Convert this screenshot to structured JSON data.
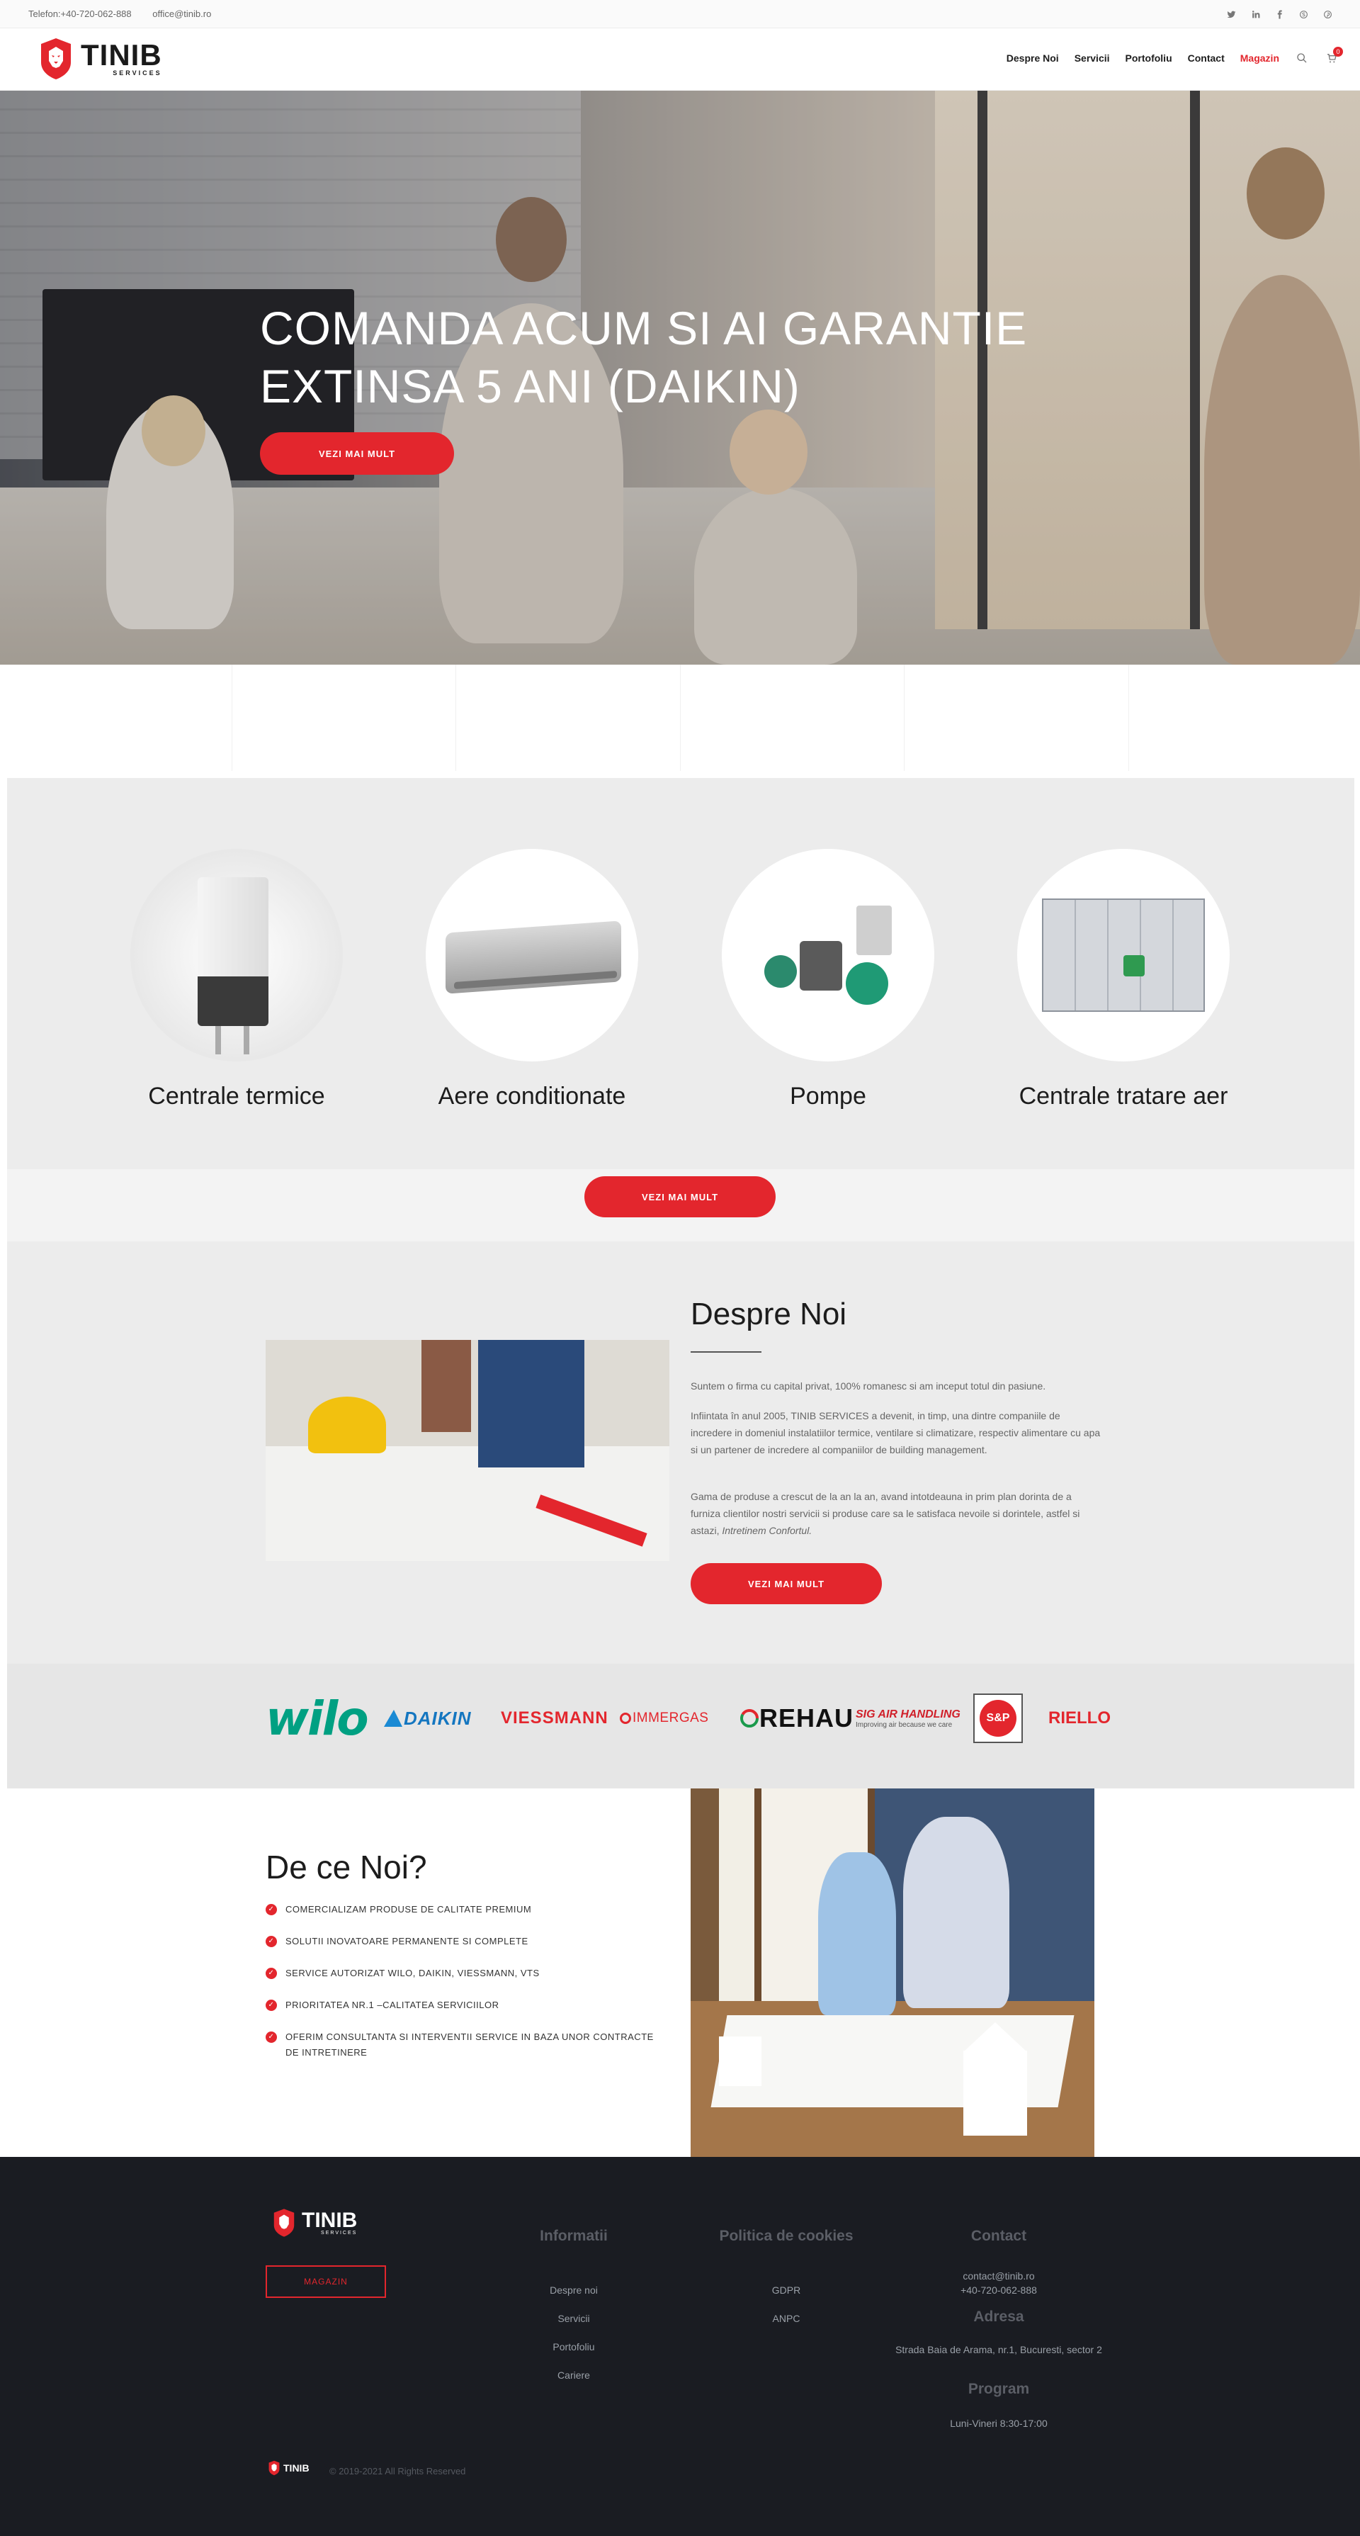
{
  "topbar": {
    "phone": "Telefon:+40-720-062-888",
    "email": "office@tinib.ro",
    "social": [
      "twitter-icon",
      "linkedin-icon",
      "facebook-icon",
      "skype-icon",
      "pinterest-icon"
    ]
  },
  "header": {
    "logo_main": "TINIB",
    "logo_sub": "SERVICES",
    "nav": [
      "Despre Noi",
      "Servicii",
      "Portofoliu",
      "Contact",
      "Magazin"
    ],
    "cart_count": "0"
  },
  "hero": {
    "title_line1": "COMANDA ACUM SI AI GARANTIE",
    "title_line2": "EXTINSA 5 ANI (DAIKIN)",
    "button": "VEZI MAI MULT"
  },
  "products": {
    "items": [
      "Centrale termice",
      "Aere conditionate",
      "Pompe",
      "Centrale tratare aer"
    ],
    "button": "VEZI MAI MULT"
  },
  "about": {
    "title": "Despre Noi",
    "p1": "Suntem o firma cu capital privat, 100% romanesc si am inceput totul din pasiune.",
    "p2": "Infiintata în anul 2005, TINIB SERVICES a devenit, in timp, una dintre companiile de incredere in domeniul instalatiilor termice, ventilare si climatizare, respectiv alimentare cu apa si un partener de incredere al companiilor de building management.",
    "p3": "Gama de produse a crescut de la an la an, avand intotdeauna in prim plan dorinta de a furniza clientilor nostri servicii si produse care sa le satisfaca nevoile si dorintele, astfel si astazi,",
    "p3_em": "Intretinem Confortul.",
    "button": "VEZI MAI MULT"
  },
  "brands": [
    "wilo",
    "DAIKIN",
    "VIESSMANN",
    "IMMERGAS",
    "REHAU",
    "SIG AIR HANDLING",
    "S&P",
    "RIELLO"
  ],
  "brands_extra": {
    "sig_tagline": "Improving air because we care"
  },
  "why": {
    "title": "De ce Noi?",
    "items": [
      "COMERCIALIZAM PRODUSE DE CALITATE PREMIUM",
      "SOLUTII INOVATOARE PERMANENTE SI COMPLETE",
      "SERVICE AUTORIZAT WILO, DAIKIN, VIESSMANN, VTS",
      "PRIORITATEA NR.1 –CALITATEA SERVICIILOR",
      "OFERIM CONSULTANTA SI INTERVENTII SERVICE IN BAZA UNOR CONTRACTE DE INTRETINERE"
    ]
  },
  "footer": {
    "logo_main": "TINIB",
    "logo_sub": "SERVICES",
    "shop_button": "MAGAZIN",
    "col1_title": "Informatii",
    "col1_links": [
      "Despre noi",
      "Servicii",
      "Portofoliu",
      "Cariere"
    ],
    "col2_title": "Politica de cookies",
    "col2_links": [
      "GDPR",
      "ANPC"
    ],
    "contact_title": "Contact",
    "contact_email": "contact@tinib.ro",
    "contact_phone": "+40-720-062-888",
    "address_title": "Adresa",
    "address": "Strada Baia de Arama, nr.1, Bucuresti, sector 2",
    "program_title": "Program",
    "program": "Luni-Vineri 8:30-17:00",
    "copyright": "© 2019-2021 All Rights Reserved"
  },
  "colors": {
    "accent": "#e3262d",
    "footer_bg": "#1a1c22",
    "section_bg": "#ececec"
  }
}
